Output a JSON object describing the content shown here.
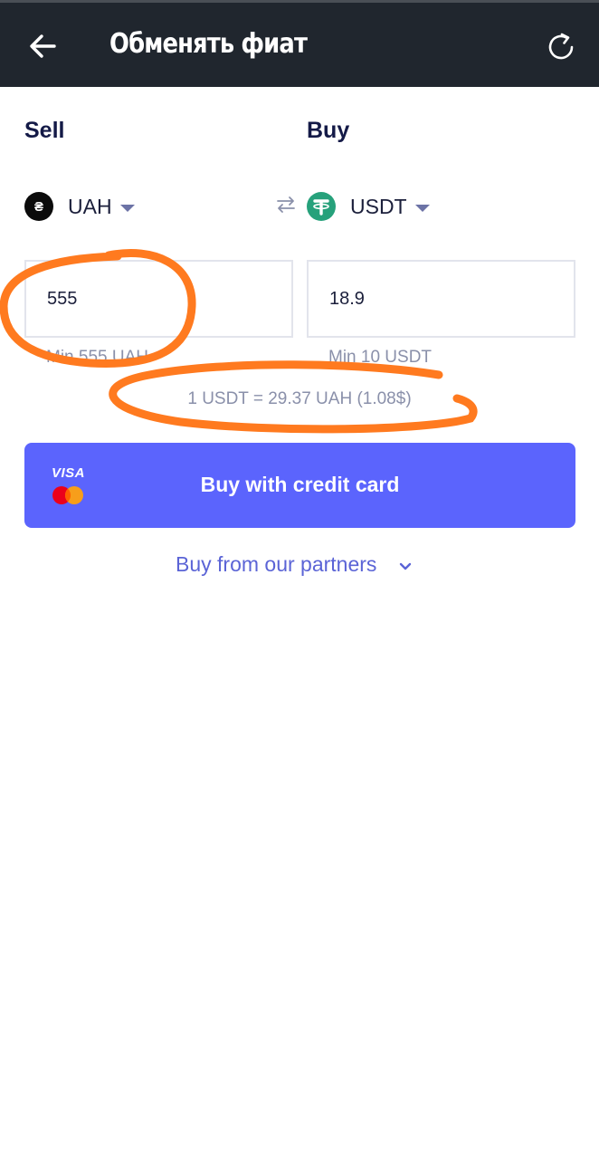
{
  "header": {
    "title": "Обменять фиат",
    "back_icon": "arrow-left-icon",
    "refresh_icon": "refresh-icon"
  },
  "sell": {
    "label": "Sell",
    "currency": "UAH",
    "icon": "hryvnia-icon",
    "amount": "555",
    "min": "Min 555 UAH"
  },
  "buy": {
    "label": "Buy",
    "currency": "USDT",
    "icon": "tether-icon",
    "amount": "18.9",
    "min": "Min 10 USDT"
  },
  "swap_icon": "swap-arrows-icon",
  "rate": "1 USDT = 29.37 UAH (1.08$)",
  "card_button": {
    "label": "Buy with credit card",
    "visa": "VISA",
    "logo": "mastercard-icon"
  },
  "partners": {
    "label": "Buy from our partners",
    "icon": "chevron-down-icon"
  },
  "colors": {
    "header_bg": "#20262e",
    "accent": "#5b64fd",
    "annotation": "#ff7a1f"
  }
}
